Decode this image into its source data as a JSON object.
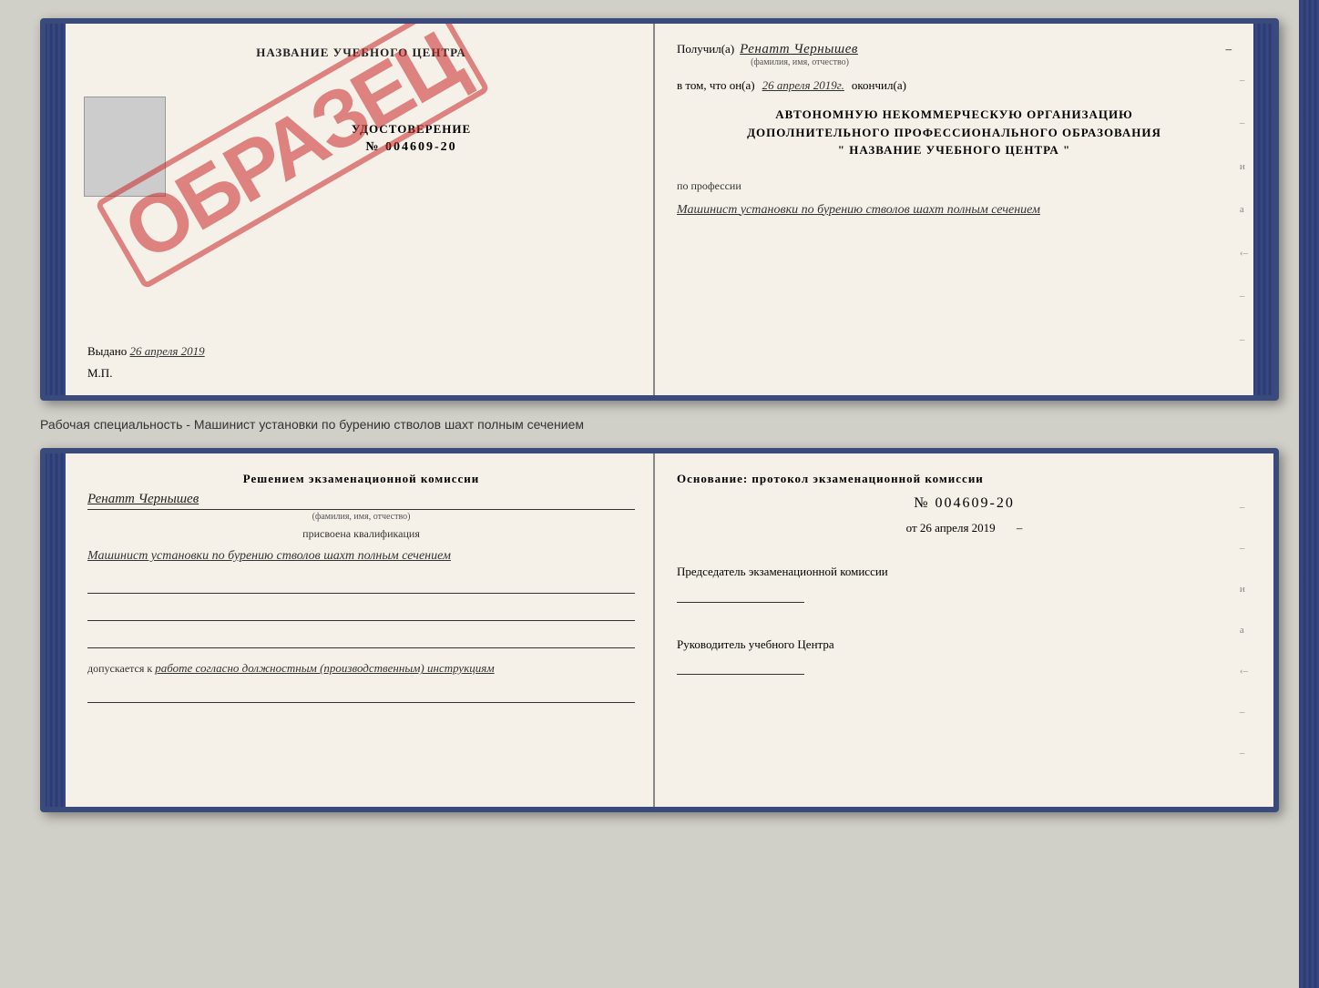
{
  "top_cert": {
    "left": {
      "institution_title": "НАЗВАНИЕ УЧЕБНОГО ЦЕНТРА",
      "stamp_text": "ОБРАЗЕЦ",
      "doc_title": "УДОСТОВЕРЕНИЕ",
      "doc_number": "№ 004609-20",
      "issued_label": "Выдано",
      "issued_date": "26 апреля 2019",
      "mp_label": "М.П."
    },
    "right": {
      "received_label": "Получил(а)",
      "person_name": "Ренатт Чернышев",
      "name_subtext": "(фамилия, имя, отчество)",
      "in_that_label": "в том, что он(а)",
      "completion_date": "26 апреля 2019г.",
      "completed_label": "окончил(а)",
      "org_line1": "АВТОНОМНУЮ НЕКОММЕРЧЕСКУЮ ОРГАНИЗАЦИЮ",
      "org_line2": "ДОПОЛНИТЕЛЬНОГО ПРОФЕССИОНАЛЬНОГО ОБРАЗОВАНИЯ",
      "org_name": "\"   НАЗВАНИЕ УЧЕБНОГО ЦЕНТРА   \"",
      "profession_label": "по профессии",
      "profession_value": "Машинист установки по бурению стволов шахт полным сечением"
    }
  },
  "separator": {
    "text": "Рабочая специальность - Машинист установки по бурению стволов шахт полным сечением"
  },
  "bottom_cert": {
    "left": {
      "decision_title": "Решением экзаменационной комиссии",
      "person_name": "Ренатт Чернышев",
      "name_subtext": "(фамилия, имя, отчество)",
      "qualification_label": "присвоена квалификация",
      "qualification_value": "Машинист установки по бурению стволов шахт полным сечением",
      "allowed_label": "допускается к",
      "allowed_value": "работе согласно должностным (производственным) инструкциям"
    },
    "right": {
      "basis_label": "Основание: протокол экзаменационной комиссии",
      "protocol_number": "№ 004609-20",
      "protocol_date_prefix": "от",
      "protocol_date": "26 апреля 2019",
      "chairman_label": "Председатель экзаменационной комиссии",
      "director_label": "Руководитель учебного Центра"
    }
  }
}
